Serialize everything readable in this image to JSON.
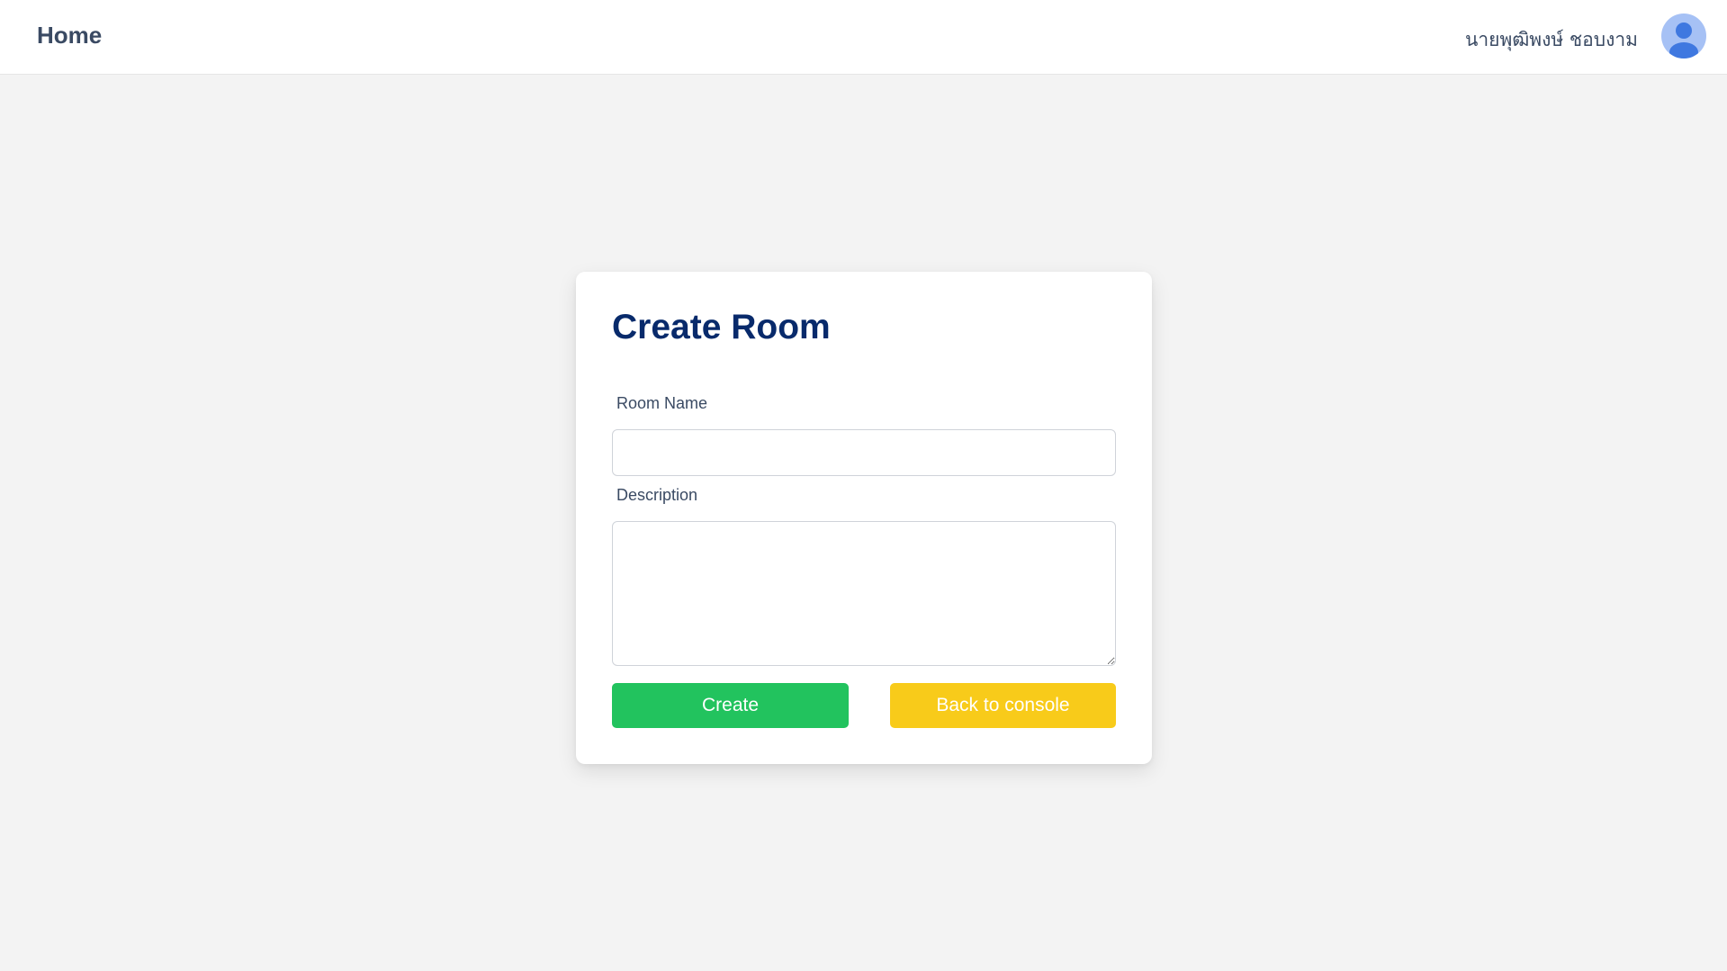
{
  "header": {
    "home_label": "Home",
    "user_name": "นายพุฒิพงษ์ ชอบงาม",
    "avatar_icon": "user-avatar-icon"
  },
  "form": {
    "title": "Create Room",
    "room_name_label": "Room Name",
    "room_name_value": "",
    "description_label": "Description",
    "description_value": "",
    "create_label": "Create",
    "back_label": "Back to console"
  },
  "colors": {
    "title": "#082a6b",
    "create_button": "#22c35e",
    "back_button": "#f8cb1a",
    "avatar_bg": "#a6c1f5",
    "avatar_fg": "#3f78e0",
    "page_bg": "#f3f3f3"
  }
}
